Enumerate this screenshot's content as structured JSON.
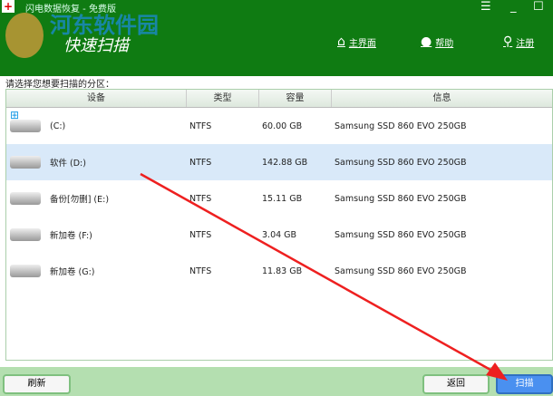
{
  "window": {
    "title": "闪电数据恢复 - 免费版",
    "menu_icon": "menu-icon",
    "minimize": "_",
    "maximize": "☐"
  },
  "header": {
    "heading": "快速扫描",
    "watermark": "河东软件园",
    "watermark_url": "www.pc0359.cn",
    "nav": [
      {
        "label": "主界面",
        "icon": "home-icon"
      },
      {
        "label": "帮助",
        "icon": "help-user-icon"
      },
      {
        "label": "注册",
        "icon": "key-icon"
      }
    ]
  },
  "prompt": "请选择您想要扫描的分区：",
  "table": {
    "columns": [
      "设备",
      "类型",
      "容量",
      "信息"
    ],
    "rows": [
      {
        "device": "(C:)",
        "type": "NTFS",
        "capacity": "60.00 GB",
        "info": "Samsung SSD 860 EVO 250GB",
        "windows": true
      },
      {
        "device": "软件 (D:)",
        "type": "NTFS",
        "capacity": "142.88 GB",
        "info": "Samsung SSD 860 EVO 250GB",
        "selected": true
      },
      {
        "device": "备份[勿删] (E:)",
        "type": "NTFS",
        "capacity": "15.11 GB",
        "info": "Samsung SSD 860 EVO 250GB"
      },
      {
        "device": "新加卷 (F:)",
        "type": "NTFS",
        "capacity": "3.04 GB",
        "info": "Samsung SSD 860 EVO 250GB"
      },
      {
        "device": "新加卷 (G:)",
        "type": "NTFS",
        "capacity": "11.83 GB",
        "info": "Samsung SSD 860 EVO 250GB"
      }
    ]
  },
  "buttons": {
    "refresh": "刷新",
    "back": "返回",
    "scan": "扫描"
  }
}
